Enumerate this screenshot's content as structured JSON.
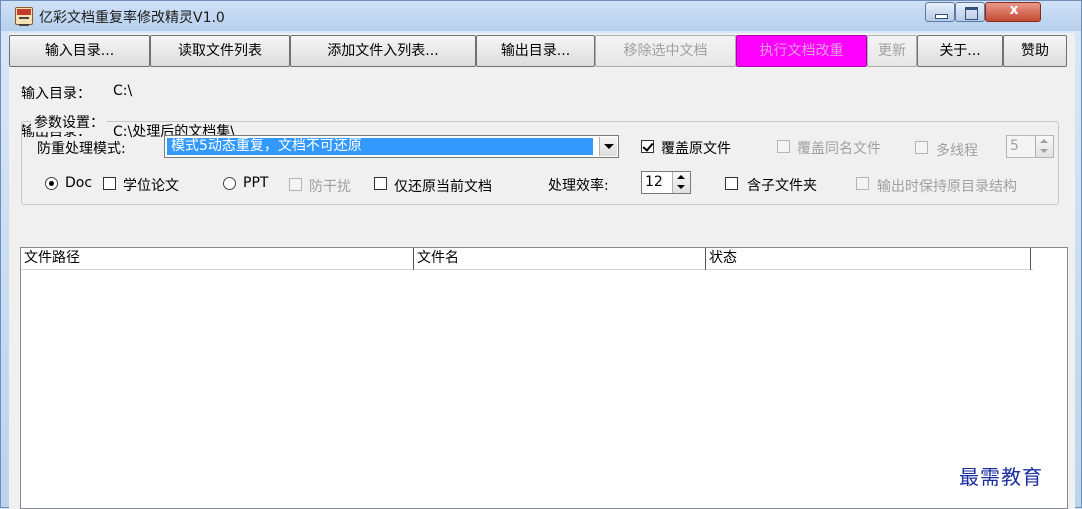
{
  "window": {
    "title": "亿彩文档重复率修改精灵V1.0",
    "close_glyph": "x"
  },
  "toolbar": {
    "input_dir": "输入目录...",
    "read_list": "读取文件列表",
    "add_files": "添加文件入列表...",
    "output_dir": "输出目录...",
    "remove_selected": "移除选中文档",
    "execute": "执行文档改重",
    "update": "更新",
    "about": "关于...",
    "sponsor": "赞助"
  },
  "paths": {
    "input_label": "输入目录：",
    "input_value": "C:\\",
    "output_label": "输出目录：",
    "output_value": "C:\\处理后的文档集\\"
  },
  "params": {
    "legend": "参数设置：",
    "mode_label": "防重处理模式:",
    "mode_value": "模式5动态重复，文档不可还原",
    "overwrite_original": "覆盖原文件",
    "overwrite_same_name": "覆盖同名文件",
    "multithread": "多线程",
    "thread_count": "5",
    "doc": "Doc",
    "thesis": "学位论文",
    "ppt": "PPT",
    "anti_interference": "防干扰",
    "restore_current": "仅还原当前文档",
    "efficiency_label": "处理效率:",
    "efficiency_value": "12",
    "include_subfolders": "含子文件夹",
    "keep_structure": "输出时保持原目录结构"
  },
  "list": {
    "columns": [
      "文件路径",
      "文件名",
      "状态"
    ]
  },
  "watermark": "最需教育",
  "colors": {
    "accent_selection": "#3399ff",
    "execute_button": "#ff00ff"
  }
}
